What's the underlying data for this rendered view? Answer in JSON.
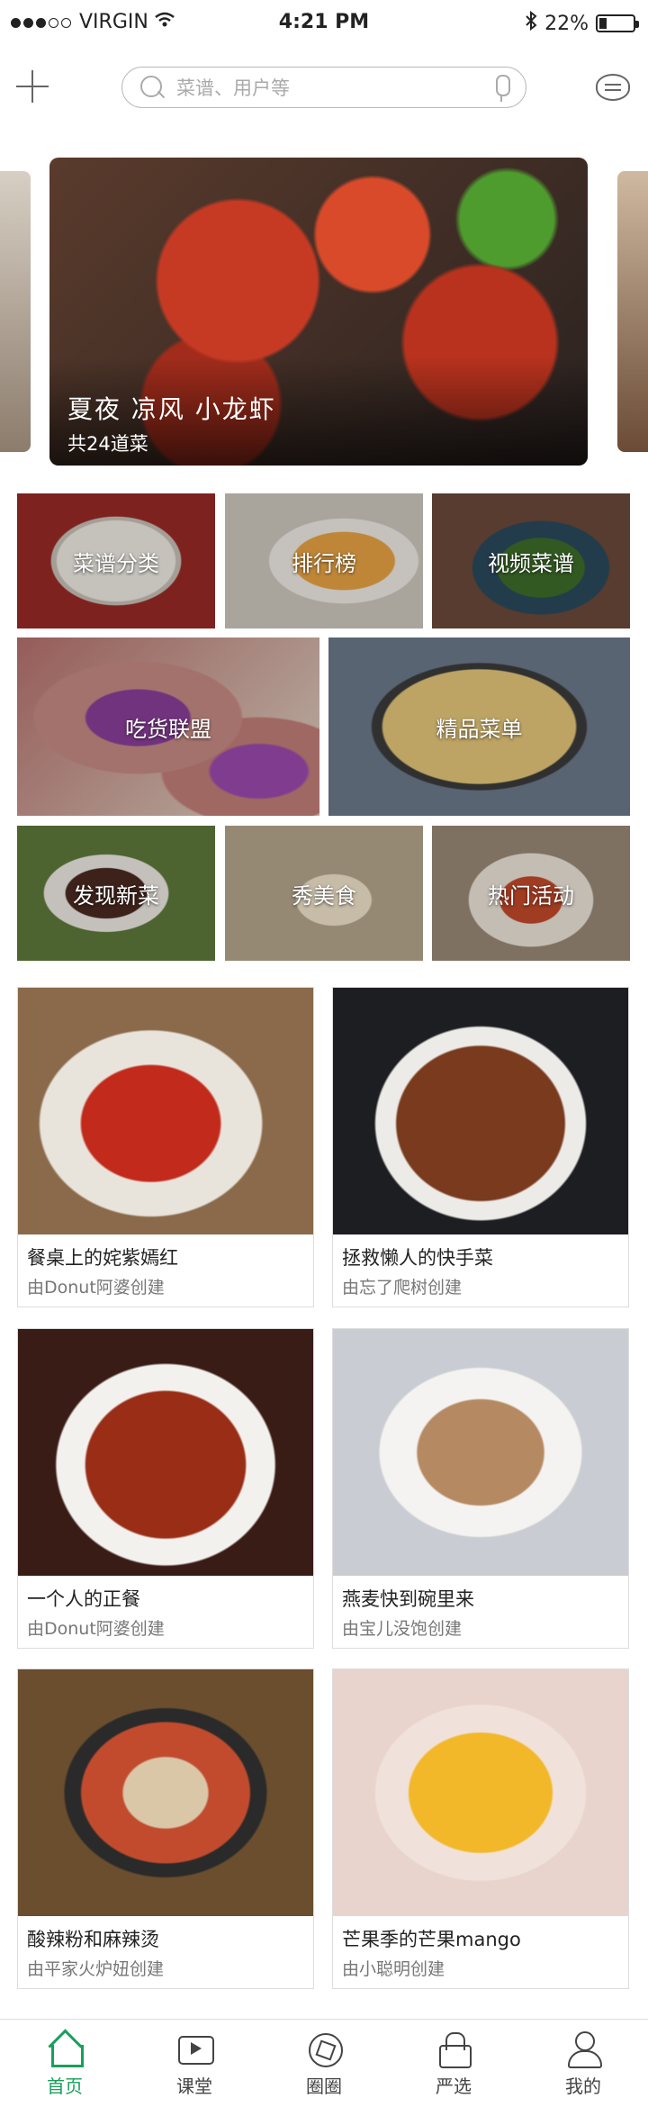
{
  "status_bar": {
    "carrier": "VIRGIN",
    "time": "4:21 PM",
    "battery": "22%",
    "battery_level": 0.22
  },
  "search": {
    "placeholder": "菜谱、用户等"
  },
  "banner": {
    "title": "夏夜 凉风 小龙虾",
    "subtitle": "共24道菜"
  },
  "categories": [
    {
      "label": "菜谱分类"
    },
    {
      "label": "排行榜"
    },
    {
      "label": "视频菜谱"
    },
    {
      "label": "吃货联盟"
    },
    {
      "label": "精品菜单"
    },
    {
      "label": "发现新菜"
    },
    {
      "label": "秀美食"
    },
    {
      "label": "热门活动"
    }
  ],
  "cards": [
    {
      "title": "餐桌上的姹紫嫣红",
      "author": "由Donut阿婆创建"
    },
    {
      "title": "拯救懒人的快手菜",
      "author": "由忘了爬树创建"
    },
    {
      "title": "一个人的正餐",
      "author": "由Donut阿婆创建"
    },
    {
      "title": "燕麦快到碗里来",
      "author": "由宝儿没饱创建"
    },
    {
      "title": "酸辣粉和麻辣烫",
      "author": "由平家火炉妞创建"
    },
    {
      "title": "芒果季的芒果mango",
      "author": "由小聪明创建"
    }
  ],
  "tabbar": [
    {
      "label": "首页",
      "icon": "home-icon"
    },
    {
      "label": "课堂",
      "icon": "play-icon"
    },
    {
      "label": "圈圈",
      "icon": "aperture-icon"
    },
    {
      "label": "严选",
      "icon": "bag-icon"
    },
    {
      "label": "我的",
      "icon": "user-icon"
    }
  ],
  "colors": {
    "accent": "#1a9e5c"
  }
}
